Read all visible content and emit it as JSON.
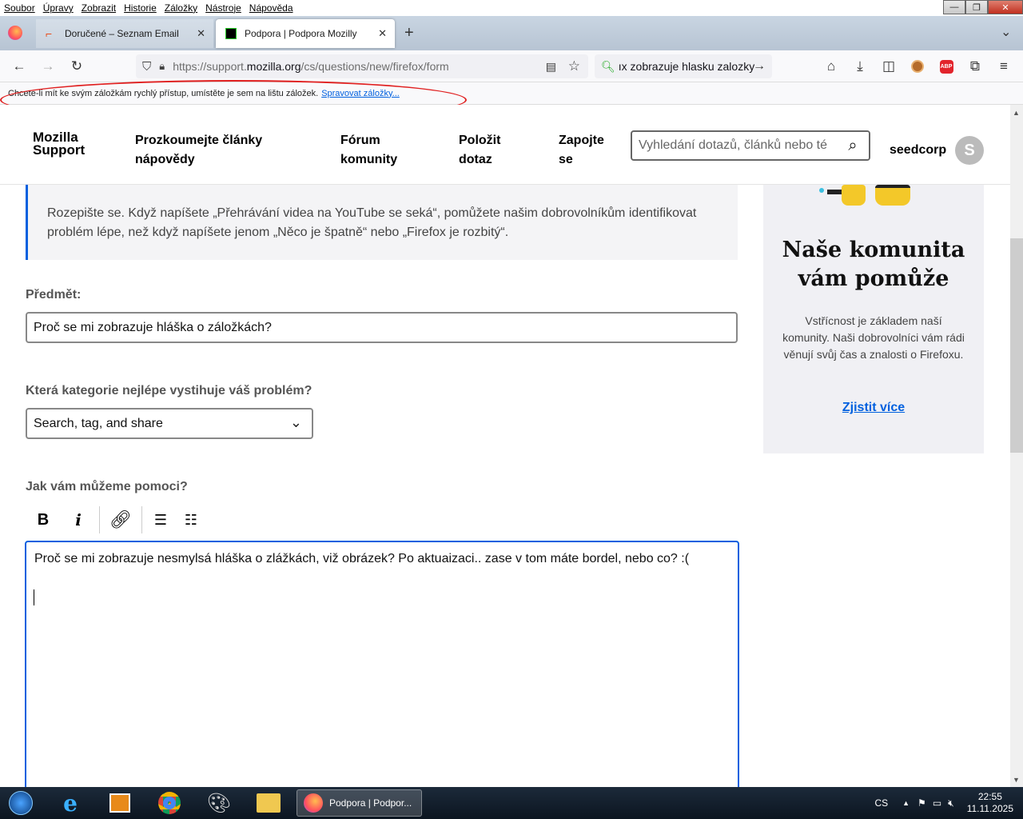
{
  "menubar": {
    "items": [
      "Soubor",
      "Úpravy",
      "Zobrazit",
      "Historie",
      "Záložky",
      "Nástroje",
      "Nápověda"
    ]
  },
  "window_controls": {
    "minimize": "—",
    "restore": "❐",
    "close": "✕"
  },
  "tabs": [
    {
      "title": "Doručené – Seznam Email"
    },
    {
      "title": "Podpora | Podpora Mozilly"
    }
  ],
  "nav": {
    "url_prefix": "https://support.",
    "url_domain": "mozilla.org",
    "url_path": "/cs/questions/new/firefox/form",
    "search_value": "ıx zobrazuje hlasku zalozky"
  },
  "bookmark_notification": {
    "text": "Chcete-li mít ke svým záložkám rychlý přístup, umístěte je sem na lištu záložek.",
    "link": "Spravovat záložky..."
  },
  "site_header": {
    "logo_line1": "Mozilla",
    "logo_line2": "Support",
    "nav": [
      {
        "line1": "Prozkoumejte články",
        "line2": "nápovědy"
      },
      {
        "line1": "Fórum",
        "line2": "komunity"
      },
      {
        "line1": "Položit",
        "line2": "dotaz"
      },
      {
        "line1": "Zapojte",
        "line2": "se"
      }
    ],
    "search_placeholder": "Vyhledání dotazů, článků nebo té",
    "username": "seedcorp",
    "avatar_letter": "S"
  },
  "form": {
    "info_text": "Rozepište se. Když napíšete „Přehrávání videa na YouTube se seká“, pomůžete našim dobrovolníkům identifikovat problém lépe, než když napíšete jenom „Něco je špatně“ nebo „Firefox je rozbitý“.",
    "subject_label": "Předmět:",
    "subject_value": "Proč se mi zobrazuje hláška o záložkách?",
    "category_label": "Která kategorie nejlépe vystihuje váš problém?",
    "category_value": "Search, tag, and share",
    "help_label": "Jak vám můžeme pomoci?",
    "editor_text": "Proč se mi zobrazuje nesmylsá hláška o zlážkách, viž obrázek? Po aktuaizaci.. zase v tom máte bordel, nebo co? :("
  },
  "editor_toolbar": {
    "bold": "B",
    "italic": "i"
  },
  "sidebar": {
    "title": "Naše komunita vám pomůže",
    "text": "Vstřícnost je základem naší komunity. Naši dobrovolníci vám rádi věnují svůj čas a znalosti o Firefoxu.",
    "link": "Zjistit více"
  },
  "taskbar": {
    "task_label": "Podpora | Podpor...",
    "lang": "CS",
    "time": "22:55",
    "date": "11.11.2025"
  }
}
